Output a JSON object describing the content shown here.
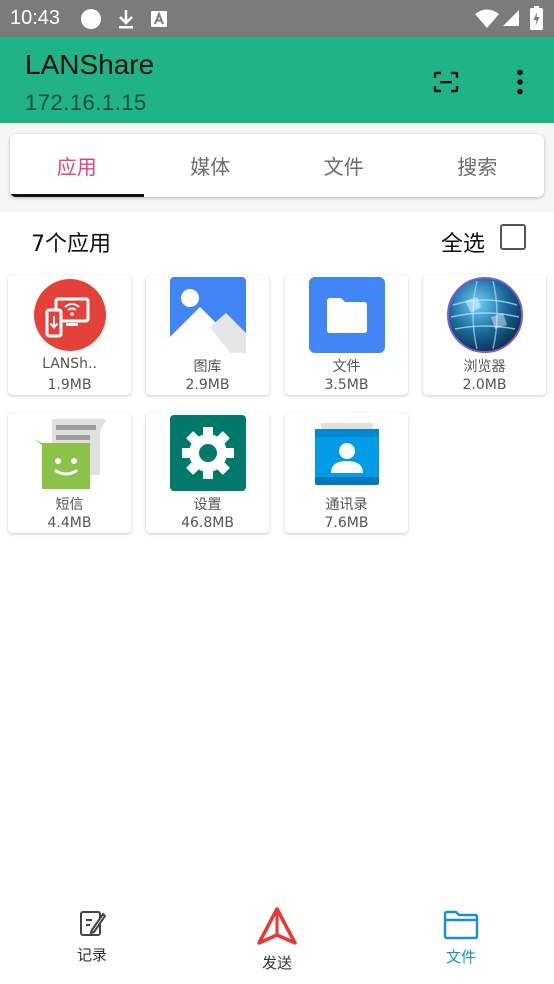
{
  "status_bar": {
    "time": "10:43"
  },
  "app": {
    "title": "LANShare",
    "ip": "172.16.1.15"
  },
  "tabs": [
    {
      "label": "应用",
      "active": true
    },
    {
      "label": "媒体",
      "active": false
    },
    {
      "label": "文件",
      "active": false
    },
    {
      "label": "搜索",
      "active": false
    }
  ],
  "summary": {
    "count_label": "7个应用",
    "select_all_label": "全选",
    "select_all_checked": false
  },
  "apps": [
    {
      "name": "LANSh..",
      "size": "1.9MB",
      "icon": "lanshare-icon"
    },
    {
      "name": "图库",
      "size": "2.9MB",
      "icon": "gallery-icon"
    },
    {
      "name": "文件",
      "size": "3.5MB",
      "icon": "files-icon"
    },
    {
      "name": "浏览器",
      "size": "2.0MB",
      "icon": "browser-icon"
    },
    {
      "name": "短信",
      "size": "4.4MB",
      "icon": "messaging-icon"
    },
    {
      "name": "设置",
      "size": "46.8MB",
      "icon": "settings-icon"
    },
    {
      "name": "通讯录",
      "size": "7.6MB",
      "icon": "contacts-icon"
    }
  ],
  "bottom_nav": [
    {
      "label": "记录",
      "icon": "history-icon",
      "active": false
    },
    {
      "label": "发送",
      "icon": "send-icon",
      "active": false
    },
    {
      "label": "文件",
      "icon": "folder-icon",
      "active": true
    }
  ],
  "colors": {
    "accent": "#21b388",
    "tab_active": "#e8437b",
    "nav_active": "#1a8fd6"
  }
}
